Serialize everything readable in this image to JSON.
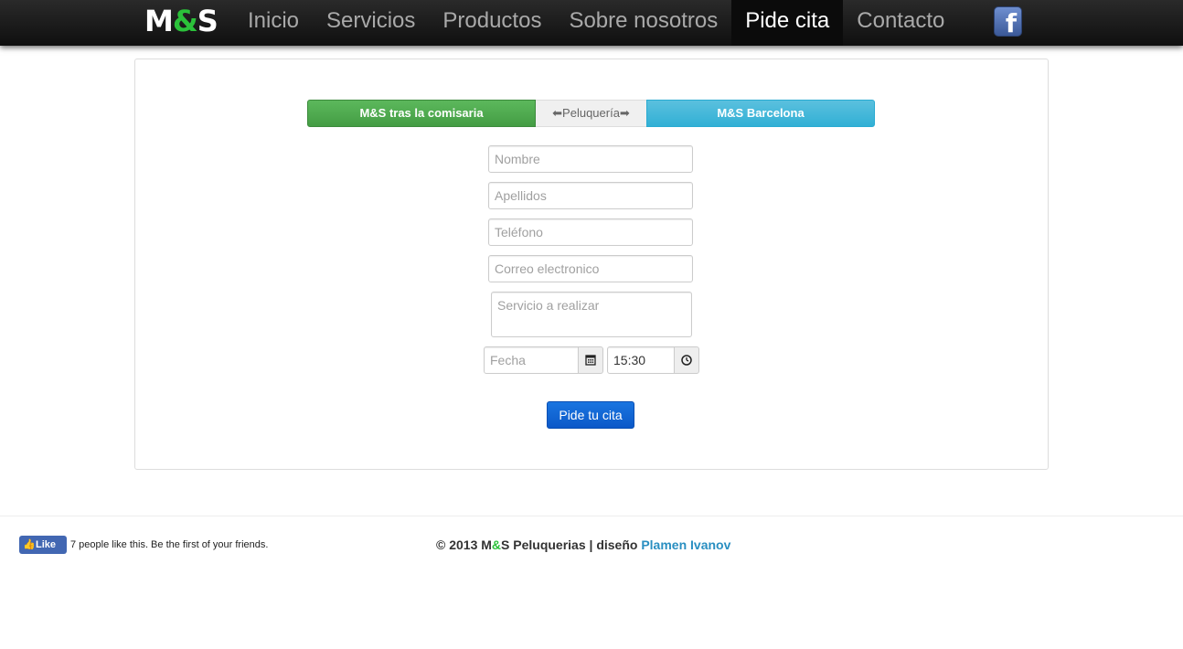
{
  "navbar": {
    "brand_left": "M",
    "brand_amp": "&",
    "brand_right": "S",
    "items": [
      "Inicio",
      "Servicios",
      "Productos",
      "Sobre nosotros",
      "Pide cita",
      "Contacto"
    ],
    "active_item": "Pide cita",
    "facebook_icon": "facebook-icon"
  },
  "locations": {
    "left": "M&S tras la comisaria",
    "middle": "⬅Peluquería➡",
    "right": "M&S Barcelona"
  },
  "form": {
    "nombre_placeholder": "Nombre",
    "apellidos_placeholder": "Apellidos",
    "telefono_placeholder": "Teléfono",
    "correo_placeholder": "Correo electronico",
    "servicio_placeholder": "Servicio a realizar",
    "fecha_placeholder": "Fecha",
    "hora_value": "15:30",
    "calendar_icon": "calendar-icon",
    "clock_icon": "clock-icon",
    "submit": "Pide tu cita"
  },
  "footer": {
    "like_button": "Like",
    "like_text": "7 people like this. Be the first of your friends.",
    "copyright_prefix": "© 2013 M",
    "copyright_amp": "&",
    "copyright_suffix": "S Peluquerias | diseño ",
    "author": "Plamen Ivanov"
  },
  "colors": {
    "navbar_bg": "#1a1a1a",
    "brand_amp": "#2bc23a",
    "location_left": "#5cb85c",
    "location_right": "#5bc0de",
    "submit": "#1a75e0",
    "author_link": "#2a8fc1"
  }
}
